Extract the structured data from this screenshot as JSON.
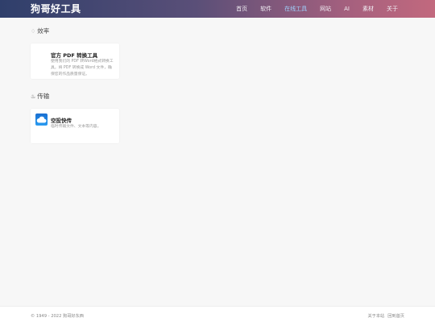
{
  "header": {
    "site_title": "狗哥好工具",
    "nav": [
      {
        "label": "首页"
      },
      {
        "label": "软件"
      },
      {
        "label": "在线工具"
      },
      {
        "label": "网站"
      },
      {
        "label": "AI"
      },
      {
        "label": "素材"
      },
      {
        "label": "关于"
      }
    ],
    "active_nav": "在线工具"
  },
  "sections": [
    {
      "icon": "sparkle-icon",
      "title": "效率",
      "cards": [
        {
          "title": "官方 PDF 转换工具",
          "description": "使用我们的 PDF 转Word格式转换工具，将 PDF 转换成 Word 文件，确保您的作品质量保证。"
        }
      ]
    },
    {
      "icon": "transfer-icon",
      "title": "传输",
      "cards": [
        {
          "title": "空投快传",
          "description": "临时传输文件、文本等内容。"
        }
      ]
    }
  ],
  "footer": {
    "copyright": "© 1949 - 2022 狗哥好东西",
    "links": [
      "关于本站",
      "回到首页"
    ]
  },
  "colors": {
    "header_gradient_start": "#2f3f6b",
    "header_gradient_end": "#c2697e",
    "active_nav": "#9fd3ff",
    "cloud_logo": "#1e88e5"
  }
}
